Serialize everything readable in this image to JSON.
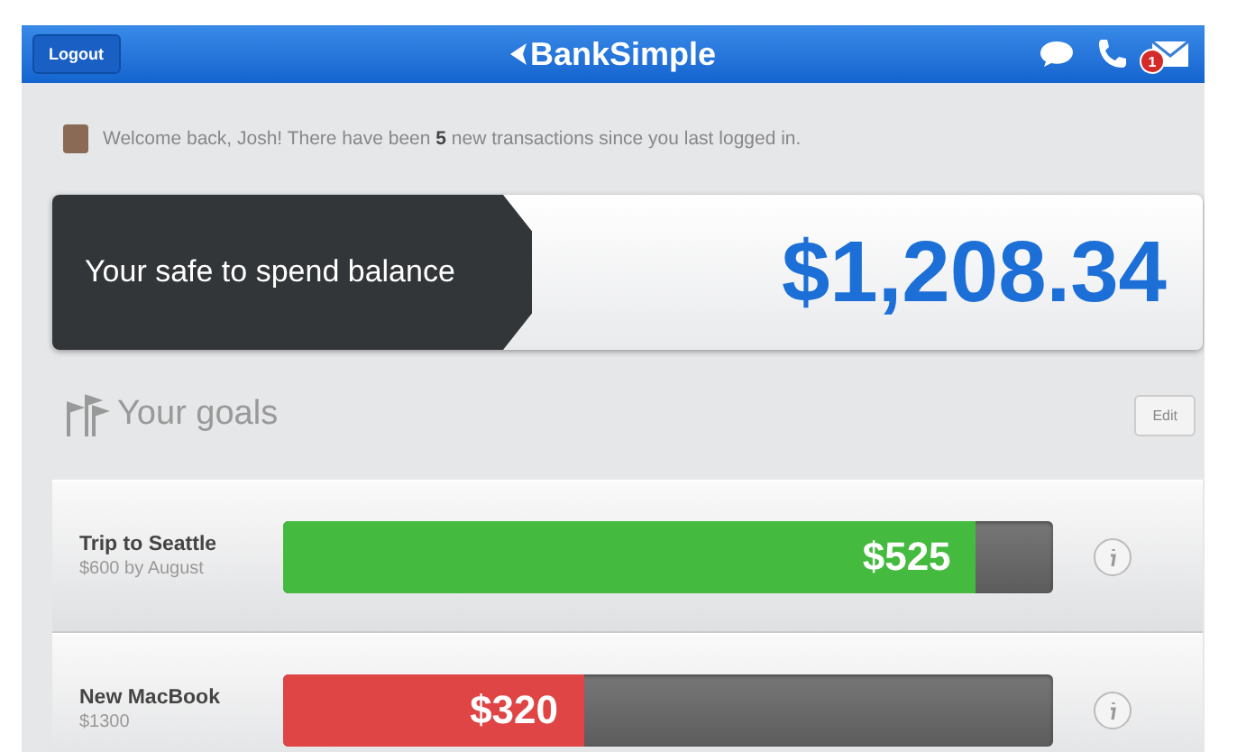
{
  "top_bar": {
    "logout_button": "Logout",
    "brand": "BankSimple",
    "mail_badge": "1"
  },
  "welcome": {
    "message": "Welcome back, Josh! There have been **5** new transactions since you last logged in."
  },
  "balance": {
    "label": "Your safe to spend balance",
    "amount": "$1,208.34"
  },
  "goals": {
    "title": "Your goals",
    "edit_button": "Edit",
    "items": [
      {
        "name": "Trip to Seattle",
        "target": "$600 by August",
        "amount": "$525",
        "level": 0.9,
        "color": "#44bb3e"
      },
      {
        "name": "New MacBook",
        "target": "$1300",
        "amount": "$320",
        "level": 0.39,
        "color": "#e04545"
      }
    ]
  }
}
